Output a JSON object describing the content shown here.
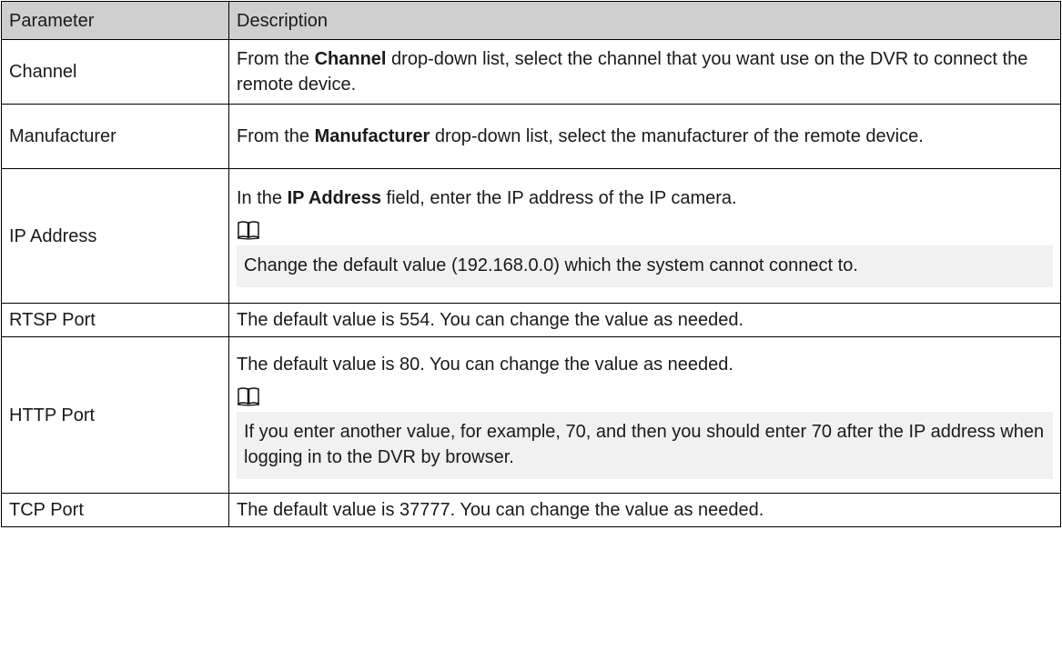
{
  "table": {
    "headers": {
      "parameter": "Parameter",
      "description": "Description"
    },
    "rows": {
      "channel": {
        "name": "Channel",
        "text_before": "From the ",
        "keyword": "Channel",
        "text_after": " drop-down list, select the channel that you want use on the DVR to connect the remote device."
      },
      "manufacturer": {
        "name": "Manufacturer",
        "text_before": "From the ",
        "keyword": "Manufacturer",
        "text_after": " drop-down list, select the manufacturer of the remote device."
      },
      "ip_address": {
        "name": "IP Address",
        "text_before": "In the ",
        "keyword": "IP Address",
        "text_after": " field, enter the IP address of the IP camera.",
        "note": "Change the default value (192.168.0.0) which the system cannot connect to."
      },
      "rtsp_port": {
        "name": "RTSP Port",
        "text": "The default value is 554. You can change the value as needed."
      },
      "http_port": {
        "name": "HTTP Port",
        "text": "The default value is 80. You can change the value as needed.",
        "note": "If you enter another value, for example, 70, and then you should enter 70 after the IP address when logging in to the DVR by browser."
      },
      "tcp_port": {
        "name": "TCP Port",
        "text": "The default value is 37777. You can change the value as needed."
      }
    }
  },
  "icons": {
    "note": "note-book-icon"
  }
}
